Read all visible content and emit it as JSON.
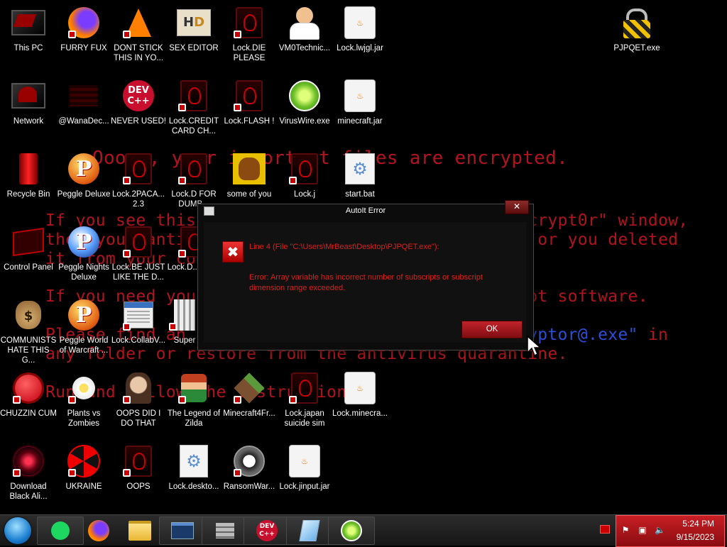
{
  "wallpaper": {
    "title": "Ooops, your important files are encrypted.",
    "line1": "If you see this text, but don't see the \"Wana Decrypt0r\" window,",
    "line2": "then your antivirus removed the decrypt software or you deleted",
    "line3": "it from your computer.",
    "line4": "If you need your files you have to run the decrypt software.",
    "line5a": "Please find an application file named ",
    "line5b": "\"@WanaDecryptor@.exe\"",
    "line5c": " in",
    "line6": "any folder or restore from the antivirus quarantine.",
    "line7": "Run and follow the instructions!"
  },
  "desktop_icons": [
    {
      "label": "This PC"
    },
    {
      "label": "FURRY FUX"
    },
    {
      "label": "DONT STICK THIS IN YO..."
    },
    {
      "label": "SEX EDITOR"
    },
    {
      "label": "Lock.DIE PLEASE"
    },
    {
      "label": "VM0Technic..."
    },
    {
      "label": "Lock.lwjgl.jar"
    },
    {
      "label": "PJPQET.exe"
    },
    {
      "label": "Network"
    },
    {
      "label": "@WanaDec..."
    },
    {
      "label": "NEVER USED!"
    },
    {
      "label": "Lock.CREDIT CARD CH..."
    },
    {
      "label": "Lock.FLASH !"
    },
    {
      "label": "VirusWire.exe"
    },
    {
      "label": "minecraft.jar"
    },
    {
      "label": "Recycle Bin"
    },
    {
      "label": "Peggle Deluxe"
    },
    {
      "label": "Lock.2PACA... 2.3"
    },
    {
      "label": "Lock.D FOR DUMB..."
    },
    {
      "label": "some of you"
    },
    {
      "label": "Lock.j"
    },
    {
      "label": "start.bat"
    },
    {
      "label": "Control Panel"
    },
    {
      "label": "Peggle Nights Deluxe"
    },
    {
      "label": "Lock.BE JUST LIKE THE D..."
    },
    {
      "label": "Lock.D... NU..."
    },
    {
      "label": "COMMUNISTS HATE THIS G..."
    },
    {
      "label": "Peggle World of Warcraft ..."
    },
    {
      "label": "Lock.CollabV..."
    },
    {
      "label": "Super"
    },
    {
      "label": "CHUZZIN CUM"
    },
    {
      "label": "Plants vs Zombies"
    },
    {
      "label": "OOPS DID I DO THAT"
    },
    {
      "label": "The Legend of Zilda"
    },
    {
      "label": "Minecraft4Fr..."
    },
    {
      "label": "Lock.japan suicide sim"
    },
    {
      "label": "Lock.minecra..."
    },
    {
      "label": "Download Black Ali..."
    },
    {
      "label": "UKRAINE"
    },
    {
      "label": "OOPS"
    },
    {
      "label": "Lock.deskto..."
    },
    {
      "label": "RansomWar..."
    },
    {
      "label": "Lock.jinput.jar"
    }
  ],
  "dialog": {
    "title": "AutoIt Error",
    "close_glyph": "✕",
    "error_glyph": "✖",
    "line1": "Line 4  (File \"C:\\Users\\MrBeast\\Desktop\\PJPQET.exe\"):",
    "line2": "Error: Array variable has incorrect number of subscripts or subscript dimension range exceeded.",
    "ok_label": "OK"
  },
  "taskbar": {
    "apps": [
      "start-orb",
      "spotify",
      "firefox",
      "file-explorer",
      "window-app",
      "wall-app",
      "dev-cpp",
      "notepad-app",
      "limewire"
    ],
    "time": "5:24 PM",
    "date": "9/15/2023"
  },
  "colors": {
    "wallpaper_text": "#b0141e",
    "wallpaper_highlight": "#2c4fd8",
    "error_text": "#e0201a",
    "tray_bg": "#c61f24"
  }
}
